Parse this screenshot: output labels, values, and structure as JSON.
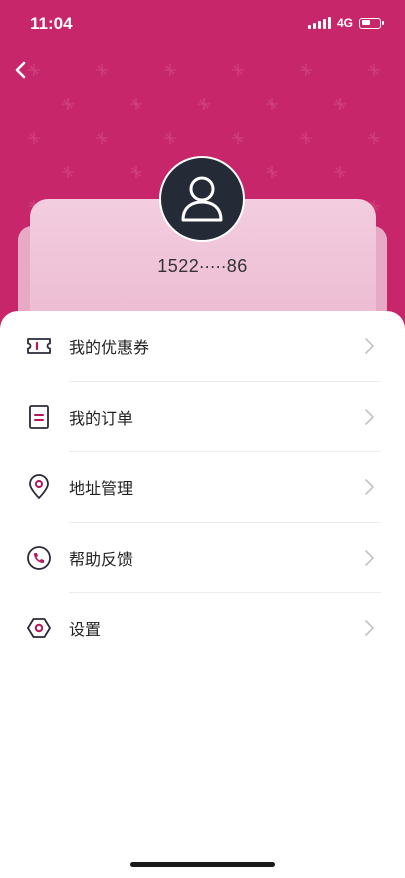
{
  "status_bar": {
    "time": "11:04",
    "network": "4G"
  },
  "colors": {
    "header_bg": "#c8266a",
    "accent_icon": "#b5175a",
    "avatar_bg": "#242a36"
  },
  "header": {
    "back_icon": "chevron-left-icon"
  },
  "profile": {
    "avatar_icon": "user-icon",
    "phone": "1522∙∙∙∙∙86"
  },
  "menu": {
    "items": [
      {
        "label": "我的优惠券",
        "icon": "coupon-icon"
      },
      {
        "label": "我的订单",
        "icon": "order-icon"
      },
      {
        "label": "地址管理",
        "icon": "location-icon"
      },
      {
        "label": "帮助反馈",
        "icon": "phone-icon"
      },
      {
        "label": "设置",
        "icon": "settings-icon"
      }
    ]
  }
}
